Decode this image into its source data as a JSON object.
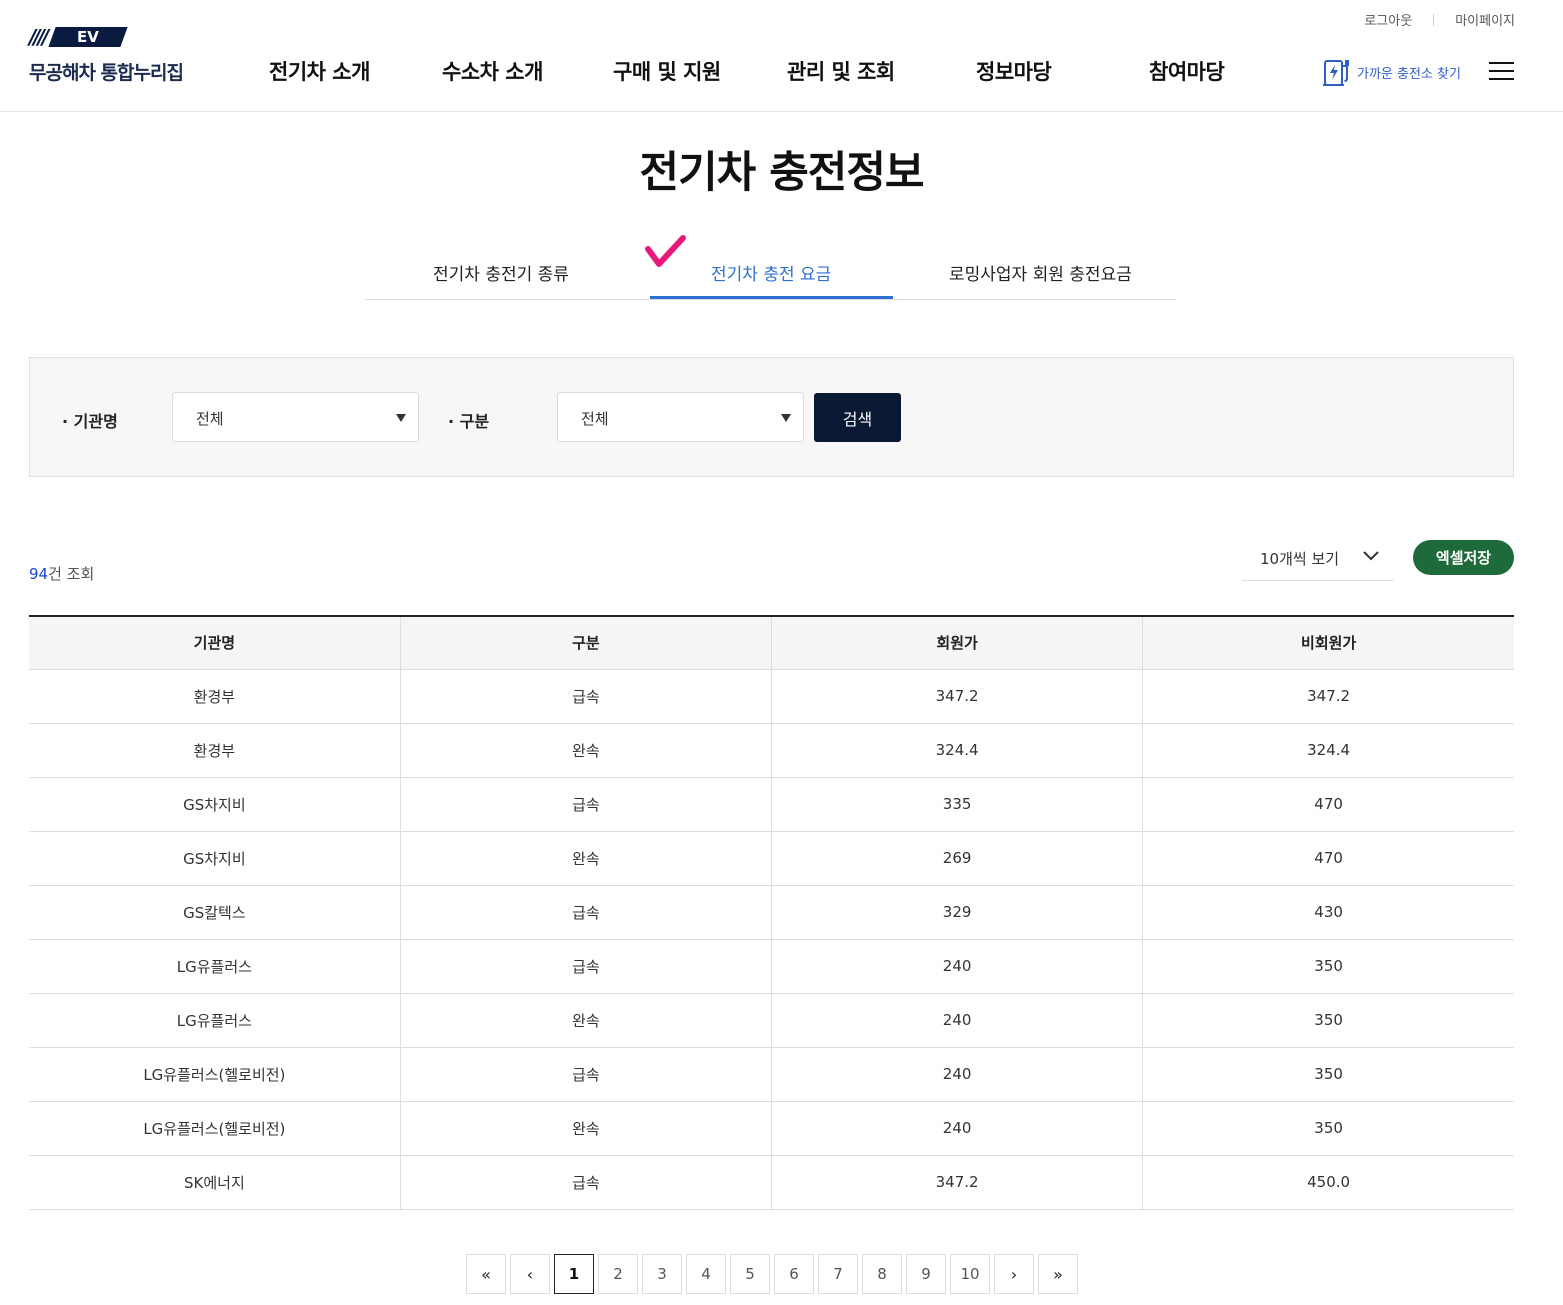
{
  "header": {
    "logo_mark": "EV",
    "logo_name": "무공해차 통합누리집",
    "util": [
      "로그아웃",
      "마이페이지"
    ],
    "nav": [
      "전기차 소개",
      "수소차 소개",
      "구매 및 지원",
      "관리 및 조회",
      "정보마당",
      "참여마당"
    ],
    "near_station": "가까운 충전소 찾기"
  },
  "page_title": "전기차 충전정보",
  "tabs": [
    {
      "label": "전기차 충전기 종류",
      "active": false
    },
    {
      "label": "전기차 충전 요금",
      "active": true
    },
    {
      "label": "로밍사업자 회원 충전요금",
      "active": false
    }
  ],
  "search": {
    "org_label": "· 기관명",
    "org_value": "전체",
    "type_label": "· 구분",
    "type_value": "전체",
    "button": "검색"
  },
  "list": {
    "count": "94",
    "count_suffix": "건 조회",
    "per_page": "10개씩 보기",
    "excel": "엑셀저장"
  },
  "table": {
    "headers": [
      "기관명",
      "구분",
      "회원가",
      "비회원가"
    ],
    "rows": [
      [
        "환경부",
        "급속",
        "347.2",
        "347.2"
      ],
      [
        "환경부",
        "완속",
        "324.4",
        "324.4"
      ],
      [
        "GS차지비",
        "급속",
        "335",
        "470"
      ],
      [
        "GS차지비",
        "완속",
        "269",
        "470"
      ],
      [
        "GS칼텍스",
        "급속",
        "329",
        "430"
      ],
      [
        "LG유플러스",
        "급속",
        "240",
        "350"
      ],
      [
        "LG유플러스",
        "완속",
        "240",
        "350"
      ],
      [
        "LG유플러스(헬로비전)",
        "급속",
        "240",
        "350"
      ],
      [
        "LG유플러스(헬로비전)",
        "완속",
        "240",
        "350"
      ],
      [
        "SK에너지",
        "급속",
        "347.2",
        "450.0"
      ]
    ]
  },
  "pagination": {
    "first": "«",
    "prev": "‹",
    "pages": [
      "1",
      "2",
      "3",
      "4",
      "5",
      "6",
      "7",
      "8",
      "9",
      "10"
    ],
    "current": "1",
    "next": "›",
    "last": "»"
  },
  "colors": {
    "accent": "#2f6fd1",
    "navy": "#0b1834",
    "excel": "#1f6a3a",
    "check": "#e8197a",
    "count": "#1a44d6"
  }
}
